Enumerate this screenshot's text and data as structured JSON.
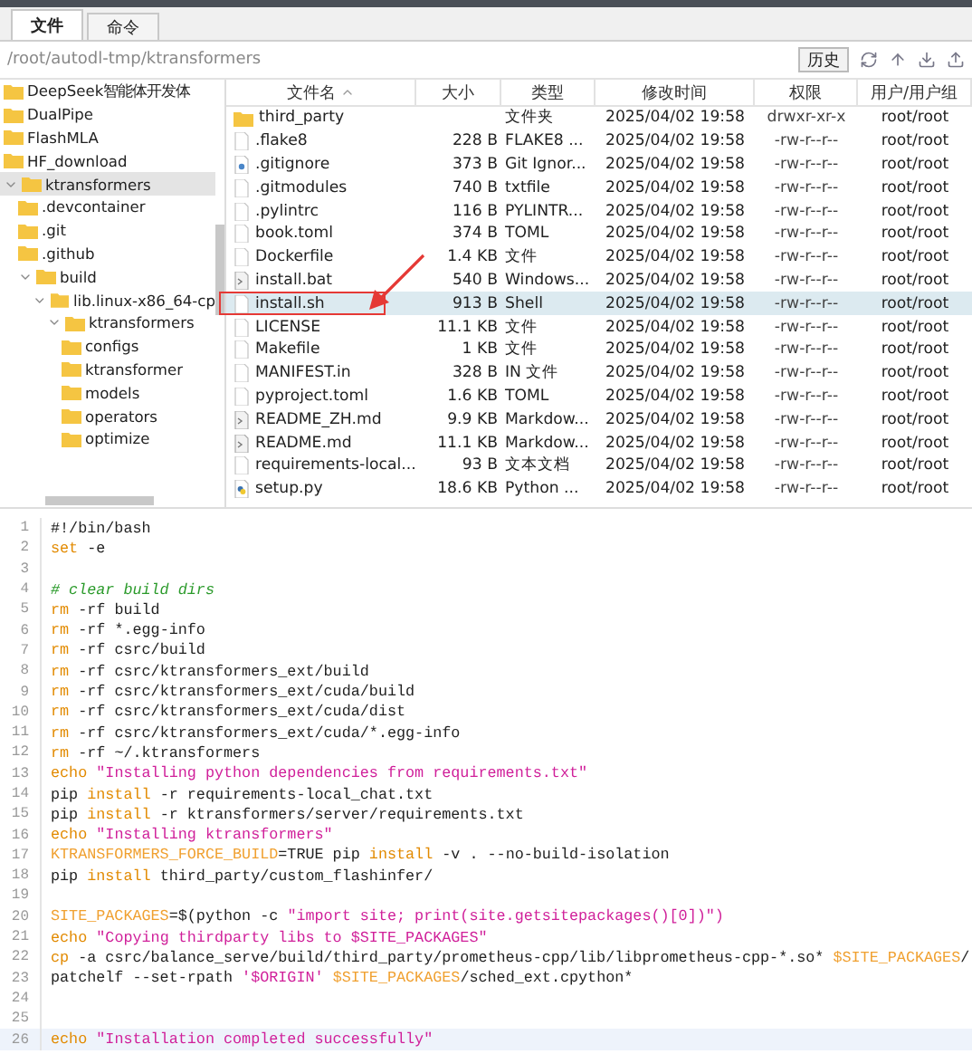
{
  "tabs": [
    {
      "label": "文件",
      "selected": true
    },
    {
      "label": "命令",
      "selected": false
    }
  ],
  "path": "/root/autodl-tmp/ktransformers",
  "history_button": "历史",
  "tree": [
    {
      "label": "DeepSeek智能体开发体",
      "selected": false
    },
    {
      "label": "DualPipe",
      "selected": false
    },
    {
      "label": "FlashMLA",
      "selected": false
    },
    {
      "label": "HF_download",
      "selected": false
    },
    {
      "label": "ktransformers",
      "selected": true,
      "expanded": true,
      "children": [
        {
          "label": ".devcontainer",
          "selected": false
        },
        {
          "label": ".git",
          "selected": false
        },
        {
          "label": ".github",
          "selected": false
        },
        {
          "label": "build",
          "selected": false,
          "expanded": true,
          "children": [
            {
              "label": "lib.linux-x86_64-cp",
              "selected": false,
              "expanded": true,
              "children": [
                {
                  "label": "ktransformers",
                  "selected": false,
                  "expanded": true,
                  "children": [
                    {
                      "label": "configs",
                      "selected": false
                    },
                    {
                      "label": "ktransformer",
                      "selected": false
                    },
                    {
                      "label": "models",
                      "selected": false
                    },
                    {
                      "label": "operators",
                      "selected": false
                    },
                    {
                      "label": "optimize",
                      "selected": false
                    }
                  ]
                }
              ]
            }
          ]
        }
      ]
    }
  ],
  "columns": [
    {
      "label": "文件名",
      "sorted": true
    },
    {
      "label": "大小",
      "sorted": false
    },
    {
      "label": "类型",
      "sorted": false
    },
    {
      "label": "修改时间",
      "sorted": false
    },
    {
      "label": "权限",
      "sorted": false
    },
    {
      "label": "用户/用户组",
      "sorted": false
    }
  ],
  "files": [
    {
      "kind": "folder",
      "name": "third_party",
      "type": "文件夹",
      "modified": "2025/04/02 19:58",
      "perms": "drwxr-xr-x",
      "owner": "root/root",
      "selected": false,
      "annotated": false
    },
    {
      "kind": "doc",
      "name": ".flake8",
      "size": "228 B",
      "type": "FLAKE8 ...",
      "modified": "2025/04/02 19:58",
      "perms": "-rw-r--r--",
      "owner": "root/root",
      "selected": false,
      "annotated": false
    },
    {
      "kind": "settings",
      "name": ".gitignore",
      "size": "373 B",
      "type": "Git Ignor...",
      "modified": "2025/04/02 19:58",
      "perms": "-rw-r--r--",
      "owner": "root/root",
      "selected": false,
      "annotated": false
    },
    {
      "kind": "doc",
      "name": ".gitmodules",
      "size": "740 B",
      "type": "txtfile",
      "modified": "2025/04/02 19:58",
      "perms": "-rw-r--r--",
      "owner": "root/root",
      "selected": false,
      "annotated": false
    },
    {
      "kind": "doc",
      "name": ".pylintrc",
      "size": "116 B",
      "type": "PYLINTR...",
      "modified": "2025/04/02 19:58",
      "perms": "-rw-r--r--",
      "owner": "root/root",
      "selected": false,
      "annotated": false
    },
    {
      "kind": "doc",
      "name": "book.toml",
      "size": "374 B",
      "type": "TOML",
      "modified": "2025/04/02 19:58",
      "perms": "-rw-r--r--",
      "owner": "root/root",
      "selected": false,
      "annotated": false
    },
    {
      "kind": "doc",
      "name": "Dockerfile",
      "size": "1.4 KB",
      "type": "文件",
      "modified": "2025/04/02 19:58",
      "perms": "-rw-r--r--",
      "owner": "root/root",
      "selected": false,
      "annotated": false
    },
    {
      "kind": "script",
      "name": "install.bat",
      "size": "540 B",
      "type": "Windows...",
      "modified": "2025/04/02 19:58",
      "perms": "-rw-r--r--",
      "owner": "root/root",
      "selected": false,
      "annotated": false
    },
    {
      "kind": "doc",
      "name": "install.sh",
      "size": "913 B",
      "type": "Shell",
      "modified": "2025/04/02 19:58",
      "perms": "-rw-r--r--",
      "owner": "root/root",
      "selected": true,
      "annotated": true
    },
    {
      "kind": "doc",
      "name": "LICENSE",
      "size": "11.1 KB",
      "type": "文件",
      "modified": "2025/04/02 19:58",
      "perms": "-rw-r--r--",
      "owner": "root/root",
      "selected": false,
      "annotated": false
    },
    {
      "kind": "doc",
      "name": "Makefile",
      "size": "1 KB",
      "type": "文件",
      "modified": "2025/04/02 19:58",
      "perms": "-rw-r--r--",
      "owner": "root/root",
      "selected": false,
      "annotated": false
    },
    {
      "kind": "doc",
      "name": "MANIFEST.in",
      "size": "328 B",
      "type": "IN 文件",
      "modified": "2025/04/02 19:58",
      "perms": "-rw-r--r--",
      "owner": "root/root",
      "selected": false,
      "annotated": false
    },
    {
      "kind": "doc",
      "name": "pyproject.toml",
      "size": "1.6 KB",
      "type": "TOML",
      "modified": "2025/04/02 19:58",
      "perms": "-rw-r--r--",
      "owner": "root/root",
      "selected": false,
      "annotated": false
    },
    {
      "kind": "script",
      "name": "README_ZH.md",
      "size": "9.9 KB",
      "type": "Markdow...",
      "modified": "2025/04/02 19:58",
      "perms": "-rw-r--r--",
      "owner": "root/root",
      "selected": false,
      "annotated": false
    },
    {
      "kind": "script",
      "name": "README.md",
      "size": "11.1 KB",
      "type": "Markdow...",
      "modified": "2025/04/02 19:58",
      "perms": "-rw-r--r--",
      "owner": "root/root",
      "selected": false,
      "annotated": false
    },
    {
      "kind": "doc",
      "name": "requirements-local...",
      "size": "93 B",
      "type": "文本文档",
      "modified": "2025/04/02 19:58",
      "perms": "-rw-r--r--",
      "owner": "root/root",
      "selected": false,
      "annotated": false
    },
    {
      "kind": "python",
      "name": "setup.py",
      "size": "18.6 KB",
      "type": "Python ...",
      "modified": "2025/04/02 19:58",
      "perms": "-rw-r--r--",
      "owner": "root/root",
      "selected": false,
      "annotated": false
    }
  ],
  "code": [
    {
      "n": "1",
      "current": false,
      "tokens": [
        {
          "kind": "plain",
          "t": "#!/bin/bash"
        }
      ]
    },
    {
      "n": "2",
      "current": false,
      "tokens": [
        {
          "kind": "cmd",
          "t": "set"
        },
        {
          "kind": "plain",
          "t": " -e"
        }
      ]
    },
    {
      "n": "3",
      "current": false
    },
    {
      "n": "4",
      "current": false,
      "tokens": [
        {
          "kind": "comment",
          "t": "# clear build dirs"
        }
      ]
    },
    {
      "n": "5",
      "current": false,
      "tokens": [
        {
          "kind": "cmd",
          "t": "rm"
        },
        {
          "kind": "plain",
          "t": " -rf build"
        }
      ]
    },
    {
      "n": "6",
      "current": false,
      "tokens": [
        {
          "kind": "cmd",
          "t": "rm"
        },
        {
          "kind": "plain",
          "t": " -rf *.egg-info"
        }
      ]
    },
    {
      "n": "7",
      "current": false,
      "tokens": [
        {
          "kind": "cmd",
          "t": "rm"
        },
        {
          "kind": "plain",
          "t": " -rf csrc/build"
        }
      ]
    },
    {
      "n": "8",
      "current": false,
      "tokens": [
        {
          "kind": "cmd",
          "t": "rm"
        },
        {
          "kind": "plain",
          "t": " -rf csrc/ktransformers_ext/build"
        }
      ]
    },
    {
      "n": "9",
      "current": false,
      "tokens": [
        {
          "kind": "cmd",
          "t": "rm"
        },
        {
          "kind": "plain",
          "t": " -rf csrc/ktransformers_ext/cuda/build"
        }
      ]
    },
    {
      "n": "10",
      "current": false,
      "tokens": [
        {
          "kind": "cmd",
          "t": "rm"
        },
        {
          "kind": "plain",
          "t": " -rf csrc/ktransformers_ext/cuda/dist"
        }
      ]
    },
    {
      "n": "11",
      "current": false,
      "tokens": [
        {
          "kind": "cmd",
          "t": "rm"
        },
        {
          "kind": "plain",
          "t": " -rf csrc/ktransformers_ext/cuda/*.egg-info"
        }
      ]
    },
    {
      "n": "12",
      "current": false,
      "tokens": [
        {
          "kind": "cmd",
          "t": "rm"
        },
        {
          "kind": "plain",
          "t": " -rf ~/.ktransformers"
        }
      ]
    },
    {
      "n": "13",
      "current": false,
      "tokens": [
        {
          "kind": "cmd",
          "t": "echo "
        },
        {
          "kind": "str",
          "t": "\"Installing python dependencies from requirements.txt\""
        }
      ]
    },
    {
      "n": "14",
      "current": false,
      "tokens": [
        {
          "kind": "plain",
          "t": "pip "
        },
        {
          "kind": "cmd",
          "t": "install"
        },
        {
          "kind": "plain",
          "t": " -r requirements-local_chat.txt"
        }
      ]
    },
    {
      "n": "15",
      "current": false,
      "tokens": [
        {
          "kind": "plain",
          "t": "pip "
        },
        {
          "kind": "cmd",
          "t": "install"
        },
        {
          "kind": "plain",
          "t": " -r ktransformers/server/requirements.txt"
        }
      ]
    },
    {
      "n": "16",
      "current": false,
      "tokens": [
        {
          "kind": "cmd",
          "t": "echo "
        },
        {
          "kind": "str",
          "t": "\"Installing ktransformers\""
        }
      ]
    },
    {
      "n": "17",
      "current": false,
      "tokens": [
        {
          "kind": "var",
          "t": "KTRANSFORMERS_FORCE_BUILD"
        },
        {
          "kind": "plain",
          "t": "=TRUE pip "
        },
        {
          "kind": "cmd",
          "t": "install"
        },
        {
          "kind": "plain",
          "t": " -v . --no-build-isolation"
        }
      ]
    },
    {
      "n": "18",
      "current": false,
      "tokens": [
        {
          "kind": "plain",
          "t": "pip "
        },
        {
          "kind": "cmd",
          "t": "install"
        },
        {
          "kind": "plain",
          "t": " third_party/custom_flashinfer/"
        }
      ]
    },
    {
      "n": "19",
      "current": false
    },
    {
      "n": "20",
      "current": false,
      "tokens": [
        {
          "kind": "var",
          "t": "SITE_PACKAGES"
        },
        {
          "kind": "plain",
          "t": "=$(python -c "
        },
        {
          "kind": "str",
          "t": "\"import site; print(site.getsitepackages()[0])\")"
        }
      ]
    },
    {
      "n": "21",
      "current": false,
      "tokens": [
        {
          "kind": "cmd",
          "t": "echo "
        },
        {
          "kind": "str",
          "t": "\"Copying thirdparty libs to $SITE_PACKAGES\""
        }
      ]
    },
    {
      "n": "22",
      "current": false,
      "tokens": [
        {
          "kind": "cmd",
          "t": "cp"
        },
        {
          "kind": "plain",
          "t": " -a csrc/balance_serve/build/third_party/prometheus-cpp/lib/libprometheus-cpp-*.so* "
        },
        {
          "kind": "var",
          "t": "$SITE_PACKAGES"
        },
        {
          "kind": "plain",
          "t": "/"
        }
      ]
    },
    {
      "n": "23",
      "current": false,
      "tokens": [
        {
          "kind": "plain",
          "t": "patchelf --set-rpath "
        },
        {
          "kind": "str",
          "t": "'$ORIGIN' "
        },
        {
          "kind": "var",
          "t": "$SITE_PACKAGES"
        },
        {
          "kind": "plain",
          "t": "/sched_ext.cpython*"
        }
      ]
    },
    {
      "n": "24",
      "current": false
    },
    {
      "n": "25",
      "current": false
    },
    {
      "n": "26",
      "current": true,
      "tokens": [
        {
          "kind": "cmd",
          "t": "echo "
        },
        {
          "kind": "str",
          "t": "\"Installation completed successfully\""
        }
      ]
    }
  ]
}
